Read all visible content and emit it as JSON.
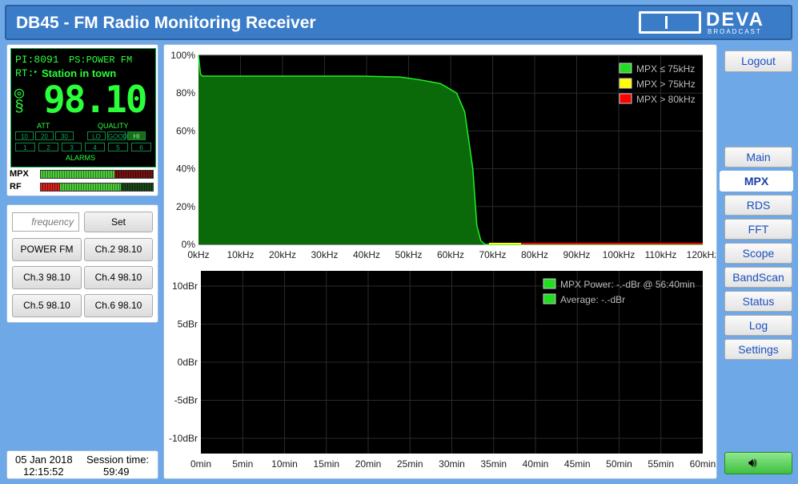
{
  "header": {
    "title": "DB45 - FM Radio Monitoring Receiver",
    "logo_text": "DEVA",
    "logo_sub": "BROADCAST"
  },
  "lcd": {
    "pi": "PI:8091",
    "ps": "PS:POWER FM",
    "rt_label": "RT:",
    "rt_text": "Station in town",
    "freq": "98.10",
    "att_label": "ATT",
    "quality_label": "QUALITY",
    "alarms_label": "ALARMS",
    "att_cells": [
      "10",
      "20",
      "30"
    ],
    "quality_cells": [
      "LO",
      "GOOD",
      "HI"
    ],
    "alarm_cells": [
      "1",
      "2",
      "3",
      "4",
      "5",
      "6"
    ]
  },
  "meters": {
    "mpx_label": "MPX",
    "rf_label": "RF"
  },
  "controls": {
    "freq_placeholder": "frequency",
    "set_label": "Set",
    "presets": [
      "POWER FM",
      "Ch.2 98.10",
      "Ch.3 98.10",
      "Ch.4 98.10",
      "Ch.5 98.10",
      "Ch.6 98.10"
    ]
  },
  "nav": {
    "logout": "Logout",
    "tabs": [
      "Main",
      "MPX",
      "RDS",
      "FFT",
      "Scope",
      "BandScan",
      "Status",
      "Log",
      "Settings"
    ],
    "active": "MPX",
    "speaker_icon": "speaker-icon"
  },
  "footer": {
    "date": "05 Jan 2018",
    "time": "12:15:52",
    "session_label": "Session time:",
    "session_value": "59:49"
  },
  "chart_data": [
    {
      "type": "area",
      "ylim": [
        0,
        100
      ],
      "yticks": [
        "100%",
        "80%",
        "60%",
        "40%",
        "20%",
        "0%"
      ],
      "xticks": [
        "0kHz",
        "10kHz",
        "20kHz",
        "30kHz",
        "40kHz",
        "50kHz",
        "60kHz",
        "70kHz",
        "80kHz",
        "90kHz",
        "100kHz",
        "110kHz",
        "120kHz"
      ],
      "legend": [
        {
          "name": "MPX ≤ 75kHz",
          "color": "#22dd22"
        },
        {
          "name": "MPX > 75kHz",
          "color": "#ffff00"
        },
        {
          "name": "MPX > 80kHz",
          "color": "#ff0000"
        }
      ],
      "x": [
        0,
        0.5,
        1,
        10,
        20,
        30,
        40,
        50,
        55,
        60,
        64,
        66,
        68,
        69,
        70,
        71,
        72,
        125
      ],
      "y": [
        100,
        90,
        89,
        89,
        89,
        89,
        89,
        88.5,
        87,
        85,
        80,
        70,
        40,
        10,
        2,
        0,
        0,
        0
      ],
      "legend_position": "top-right"
    },
    {
      "type": "line",
      "ylim": [
        -12,
        12
      ],
      "yticks": [
        "10dBr",
        "5dBr",
        "0dBr",
        "-5dBr",
        "-10dBr"
      ],
      "xticks": [
        "0min",
        "5min",
        "10min",
        "15min",
        "20min",
        "25min",
        "30min",
        "35min",
        "40min",
        "45min",
        "50min",
        "55min",
        "60min"
      ],
      "legend": [
        {
          "name": "MPX Power: -.-dBr @ 56:40min",
          "color": "#22dd22"
        },
        {
          "name": "Average: -.-dBr",
          "color": "#22dd22"
        }
      ],
      "legend_position": "top-right"
    }
  ]
}
